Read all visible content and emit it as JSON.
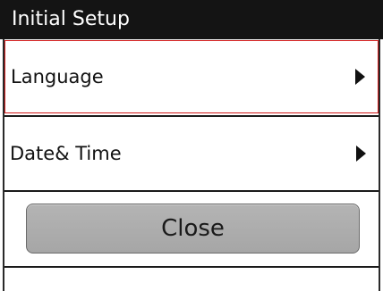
{
  "header": {
    "title": "Initial Setup"
  },
  "menu": {
    "items": [
      {
        "label": "Language",
        "selected": true
      },
      {
        "label": "Date& Time",
        "selected": false
      }
    ]
  },
  "actions": {
    "close_label": "Close"
  },
  "colors": {
    "title_bar": "#141414",
    "selection": "#d11a1a",
    "button": "#acacac"
  },
  "icons": {
    "submenu": "triangle-right-icon"
  }
}
